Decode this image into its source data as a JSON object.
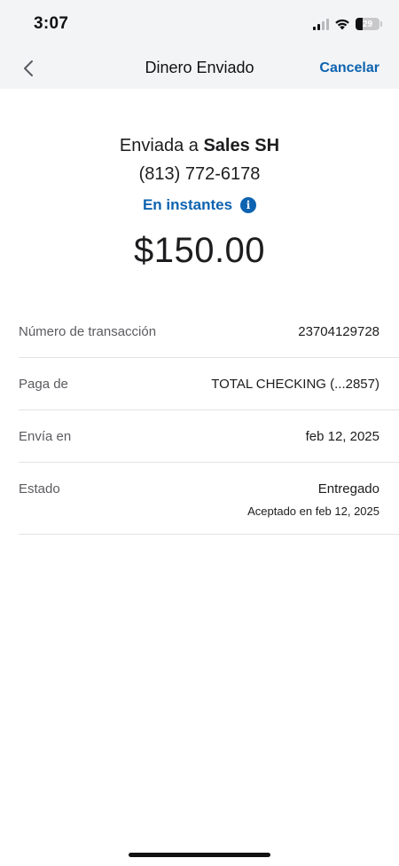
{
  "status_bar": {
    "time": "3:07",
    "battery_percent": "29",
    "battery_level": 0.29
  },
  "nav": {
    "title": "Dinero Enviado",
    "cancel_label": "Cancelar"
  },
  "summary": {
    "sent_prefix": "Enviada a",
    "recipient": "Sales SH",
    "phone": "(813) 772-6178",
    "delivery_speed": "En instantes",
    "amount": "$150.00"
  },
  "details": {
    "transaction_label": "Número de transacción",
    "transaction_value": "23704129728",
    "pay_from_label": "Paga de",
    "pay_from_value": "TOTAL CHECKING (...2857)",
    "send_on_label": "Envía en",
    "send_on_value": "feb 12, 2025",
    "status_label": "Estado",
    "status_value": "Entregado",
    "status_sub": "Aceptado en feb 12, 2025"
  },
  "colors": {
    "accent": "#0d63b0",
    "header_bg": "#f3f4f6",
    "divider": "#e3e3e6"
  },
  "icons": [
    "back-chevron-icon",
    "info-icon",
    "signal-icon",
    "wifi-icon",
    "battery-icon"
  ]
}
